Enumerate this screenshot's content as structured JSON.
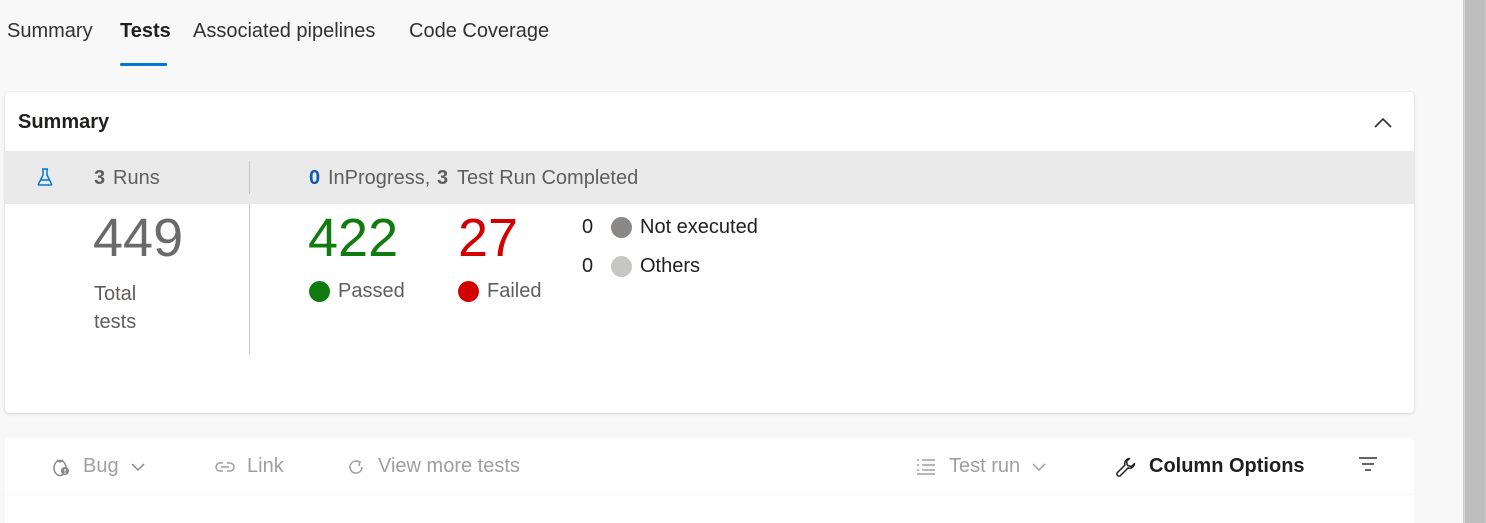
{
  "tabs": [
    {
      "label": "Summary"
    },
    {
      "label": "Tests"
    },
    {
      "label": "Associated pipelines"
    },
    {
      "label": "Code Coverage"
    }
  ],
  "summary": {
    "title": "Summary",
    "runs_count": "3",
    "runs_label": "Runs",
    "inprogress_count": "0",
    "inprogress_label": "InProgress,",
    "completed_count": "3",
    "completed_label": "Test Run Completed",
    "total": "449",
    "total_label": "Total tests",
    "passed": "422",
    "passed_label": "Passed",
    "failed": "27",
    "failed_label": "Failed",
    "not_executed_count": "0",
    "not_executed_label": "Not executed",
    "others_count": "0",
    "others_label": "Others"
  },
  "toolbar": {
    "bug_label": "Bug",
    "link_label": "Link",
    "view_more_label": "View more tests",
    "test_run_label": "Test run",
    "column_options_label": "Column Options"
  },
  "colors": {
    "accent": "#0078d4",
    "passed": "#107c10",
    "failed": "#d30000",
    "not_executed": "#8a8886",
    "others": "#c8c6c4"
  }
}
